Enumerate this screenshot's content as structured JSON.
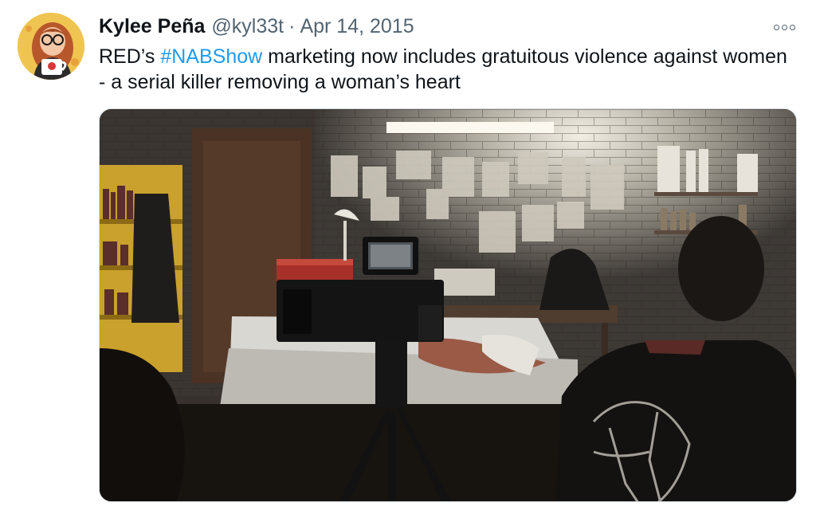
{
  "tweet": {
    "author_name": "Kylee Peña",
    "author_handle": "@kyl33t",
    "separator": "·",
    "date": "Apr 14, 2015",
    "text_before": "RED’s ",
    "hashtag": "#NABShow",
    "text_after": " marketing now includes gratuitous violence against women - a serial killer removing a woman’s heart"
  },
  "icons": {
    "more": "more-horizontal-icon"
  },
  "colors": {
    "link": "#1d9bf0",
    "secondary_text": "#536471",
    "primary_text": "#0f1419"
  }
}
